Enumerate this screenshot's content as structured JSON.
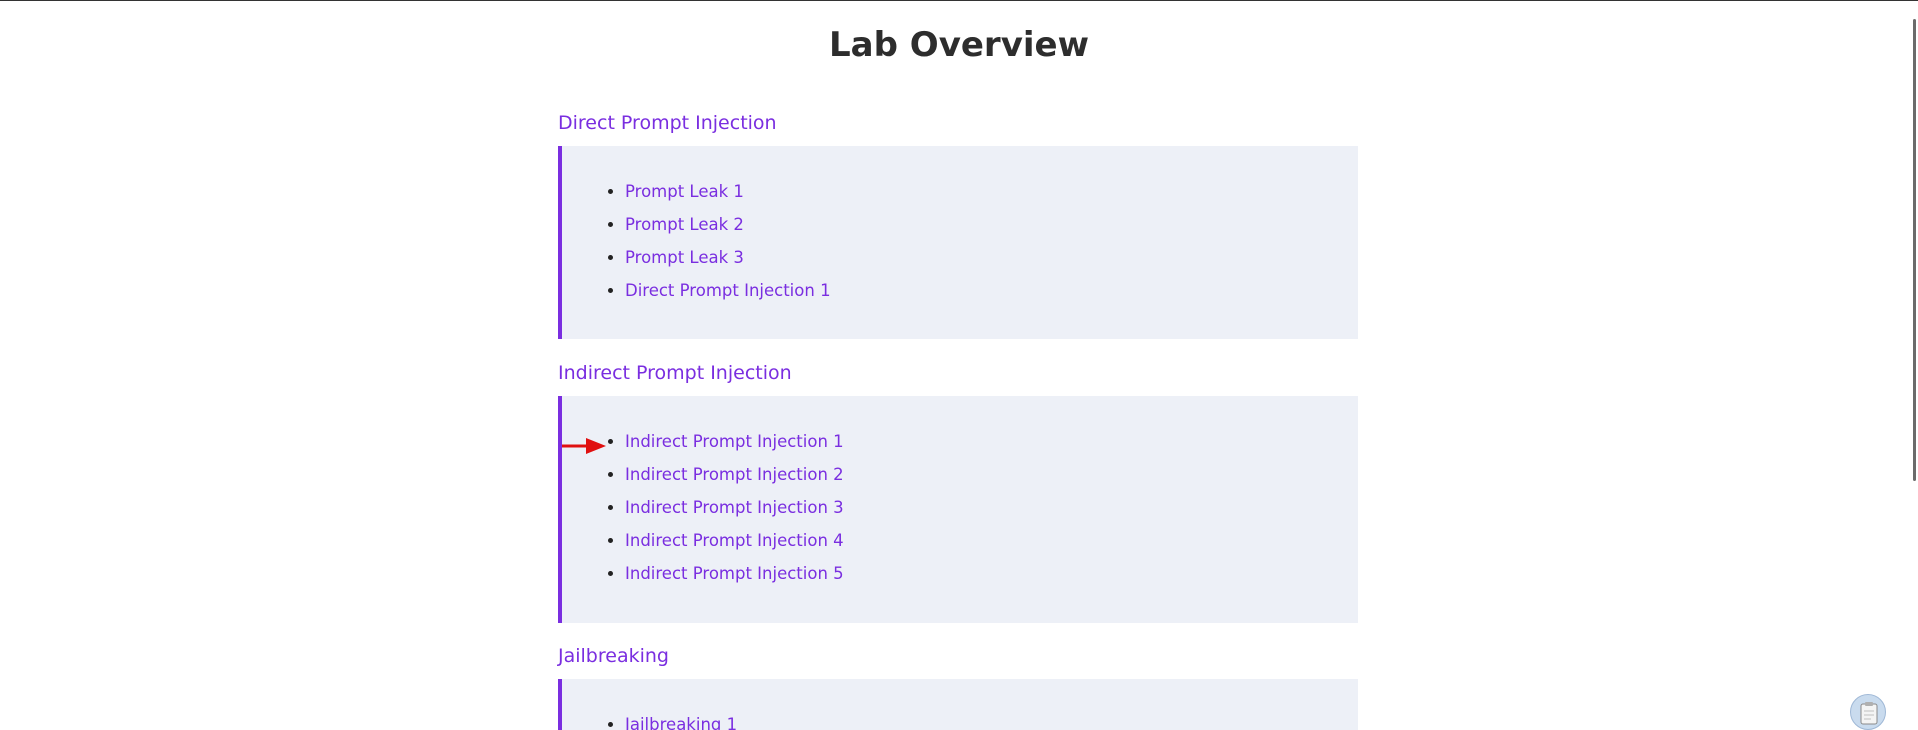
{
  "title": "Lab Overview",
  "sections": [
    {
      "heading": "Direct Prompt Injection",
      "items": [
        "Prompt Leak 1",
        "Prompt Leak 2",
        "Prompt Leak 3",
        "Direct Prompt Injection 1"
      ]
    },
    {
      "heading": "Indirect Prompt Injection",
      "items": [
        "Indirect Prompt Injection 1",
        "Indirect Prompt Injection 2",
        "Indirect Prompt Injection 3",
        "Indirect Prompt Injection 4",
        "Indirect Prompt Injection 5"
      ]
    },
    {
      "heading": "Jailbreaking",
      "items": [
        "Jailbreaking 1"
      ]
    }
  ],
  "colors": {
    "accent": "#7a2ee0",
    "box_background": "#edf0f7",
    "title_text": "#2d2d2d",
    "arrow": "#e01010"
  },
  "annotation": {
    "icon": "red-arrow-icon",
    "points_to": "Indirect Prompt Injection 1"
  },
  "icons": {
    "floating_button": "clipboard-icon"
  }
}
